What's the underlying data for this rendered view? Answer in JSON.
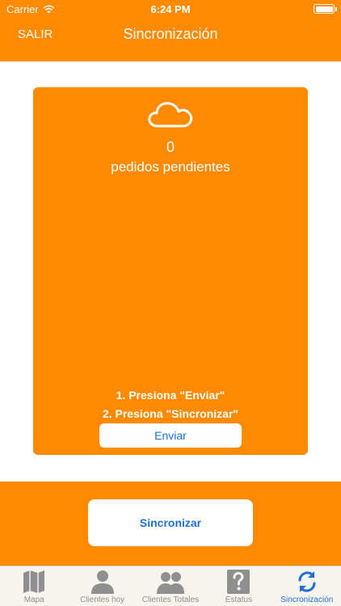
{
  "status_bar": {
    "carrier": "Carrier",
    "time": "6:24 PM"
  },
  "nav": {
    "back_label": "SALIR",
    "title": "Sincronización"
  },
  "card": {
    "pending_count": "0",
    "pending_label": "pedidos pendientes",
    "step1": "1. Presiona \"Enviar\"",
    "step2": "2. Presiona \"Sincronizar\"",
    "send_button": "Enviar"
  },
  "sync_button": "Sincronizar",
  "tabs": [
    {
      "label": "Mapa",
      "icon": "map-icon",
      "active": false
    },
    {
      "label": "Clientes hoy",
      "icon": "person-icon",
      "active": false
    },
    {
      "label": "Clientes Totales",
      "icon": "people-icon",
      "active": false
    },
    {
      "label": "Estatus",
      "icon": "question-icon",
      "active": false
    },
    {
      "label": "Sincronización",
      "icon": "sync-icon",
      "active": true
    }
  ],
  "colors": {
    "brand_orange": "#ff8a00",
    "active_blue": "#1f6fd6",
    "inactive_gray": "#8f8f8f"
  }
}
